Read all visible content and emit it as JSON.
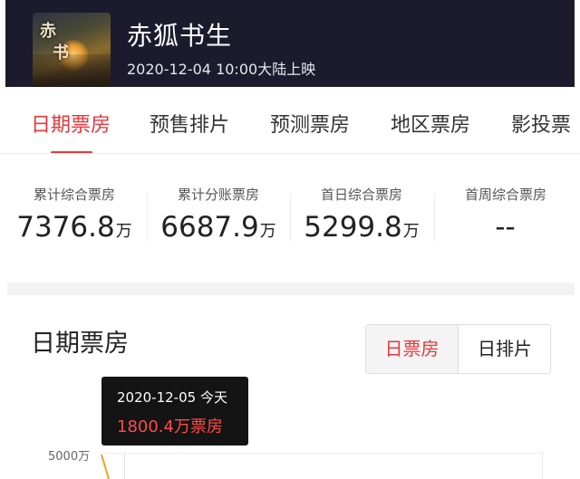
{
  "header": {
    "poster_text": "赤狐书生",
    "title": "赤狐书生",
    "release": "2020-12-04 10:00大陆上映"
  },
  "tabs": [
    {
      "label": "日期票房",
      "active": true
    },
    {
      "label": "预售排片",
      "active": false
    },
    {
      "label": "预测票房",
      "active": false
    },
    {
      "label": "地区票房",
      "active": false
    },
    {
      "label": "影投票",
      "active": false
    }
  ],
  "stats": [
    {
      "label": "累计综合票房",
      "value": "7376.8",
      "unit": "万"
    },
    {
      "label": "累计分账票房",
      "value": "6687.9",
      "unit": "万"
    },
    {
      "label": "首日综合票房",
      "value": "5299.8",
      "unit": "万"
    },
    {
      "label": "首周综合票房",
      "value": "--",
      "unit": ""
    }
  ],
  "section": {
    "title": "日期票房",
    "toggle": {
      "on": "日票房",
      "off": "日排片"
    }
  },
  "chart": {
    "tooltip": {
      "date": "2020-12-05 今天",
      "amount": "1800.4万票房"
    },
    "y_tick": "5000万",
    "accent": "#e8363c",
    "line_color": "#f0a020"
  },
  "chart_data": {
    "type": "line",
    "yticks": [
      "5000万"
    ],
    "tooltip_point": {
      "x": "2020-12-05",
      "y": 1800.4
    }
  },
  "colors": {
    "accent": "#e8363c",
    "header_bg": "#1c1b2e"
  }
}
